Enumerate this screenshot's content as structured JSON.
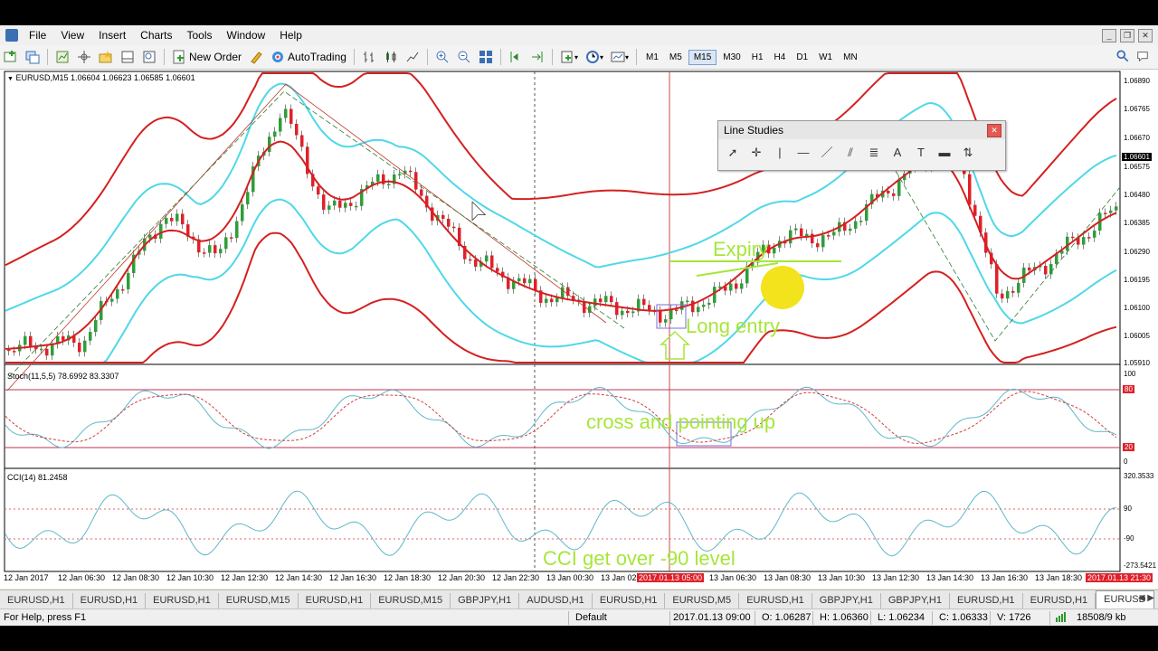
{
  "menu": [
    "File",
    "View",
    "Insert",
    "Charts",
    "Tools",
    "Window",
    "Help"
  ],
  "toolbar": {
    "new_order": "New Order",
    "autotrading": "AutoTrading",
    "timeframes": [
      "M1",
      "M5",
      "M15",
      "M30",
      "H1",
      "H4",
      "D1",
      "W1",
      "MN"
    ],
    "active_tf": "M15"
  },
  "chart": {
    "header": "EURUSD,M15  1.06604 1.06623 1.06585 1.06601",
    "stoch_label": "Stoch(11,5,5) 78.6992 83.3307",
    "cci_label": "CCI(14) 81.2458",
    "price_labels": [
      "1.06890",
      "1.06765",
      "1.06670",
      "1.06601",
      "1.06575",
      "1.06480",
      "1.06385",
      "1.06290",
      "1.06195",
      "1.06100",
      "1.06005",
      "1.05910"
    ],
    "stoch_levels": [
      "100",
      "80",
      "20",
      "0"
    ],
    "cci_levels": [
      "320.3533",
      "90",
      "-90",
      "-273.5421"
    ],
    "time_labels": [
      "12 Jan 2017",
      "12 Jan 06:30",
      "12 Jan 08:30",
      "12 Jan 10:30",
      "12 Jan 12:30",
      "12 Jan 14:30",
      "12 Jan 16:30",
      "12 Jan 18:30",
      "12 Jan 20:30",
      "12 Jan 22:30",
      "13 Jan 00:30",
      "13 Jan 02",
      "2017.01.13 05:00",
      "13 Jan 06:30",
      "13 Jan 08:30",
      "13 Jan 10:30",
      "13 Jan 12:30",
      "13 Jan 14:30",
      "13 Jan 16:30",
      "13 Jan 18:30",
      "2017.01.13 21:30"
    ],
    "annotations": {
      "expiry": "Expiry",
      "long_entry": "Long entry",
      "stoch_note": "cross and pointing up",
      "cci_note": "CCI get over -90 level"
    },
    "colors": {
      "bullish": "#2e9e3a",
      "bearish": "#e0202a",
      "outer_band": "#d42020",
      "inner_band": "#4fd8e8",
      "annotation": "#a6e63a"
    }
  },
  "line_studies": {
    "title": "Line Studies"
  },
  "tabs": [
    "EURUSD,H1",
    "EURUSD,H1",
    "EURUSD,H1",
    "EURUSD,M15",
    "EURUSD,H1",
    "EURUSD,M15",
    "GBPJPY,H1",
    "AUDUSD,H1",
    "EURUSD,H1",
    "EURUSD,M5",
    "EURUSD,H1",
    "GBPJPY,H1",
    "GBPJPY,H1",
    "EURUSD,H1",
    "EURUSD,H1",
    "EURUSD"
  ],
  "status": {
    "help": "For Help, press F1",
    "profile": "Default",
    "datetime": "2017.01.13 09:00",
    "open": "O: 1.06287",
    "high": "H: 1.06360",
    "low": "L: 1.06234",
    "close": "C: 1.06333",
    "volume": "V: 1726",
    "traffic": "18508/9 kb"
  }
}
